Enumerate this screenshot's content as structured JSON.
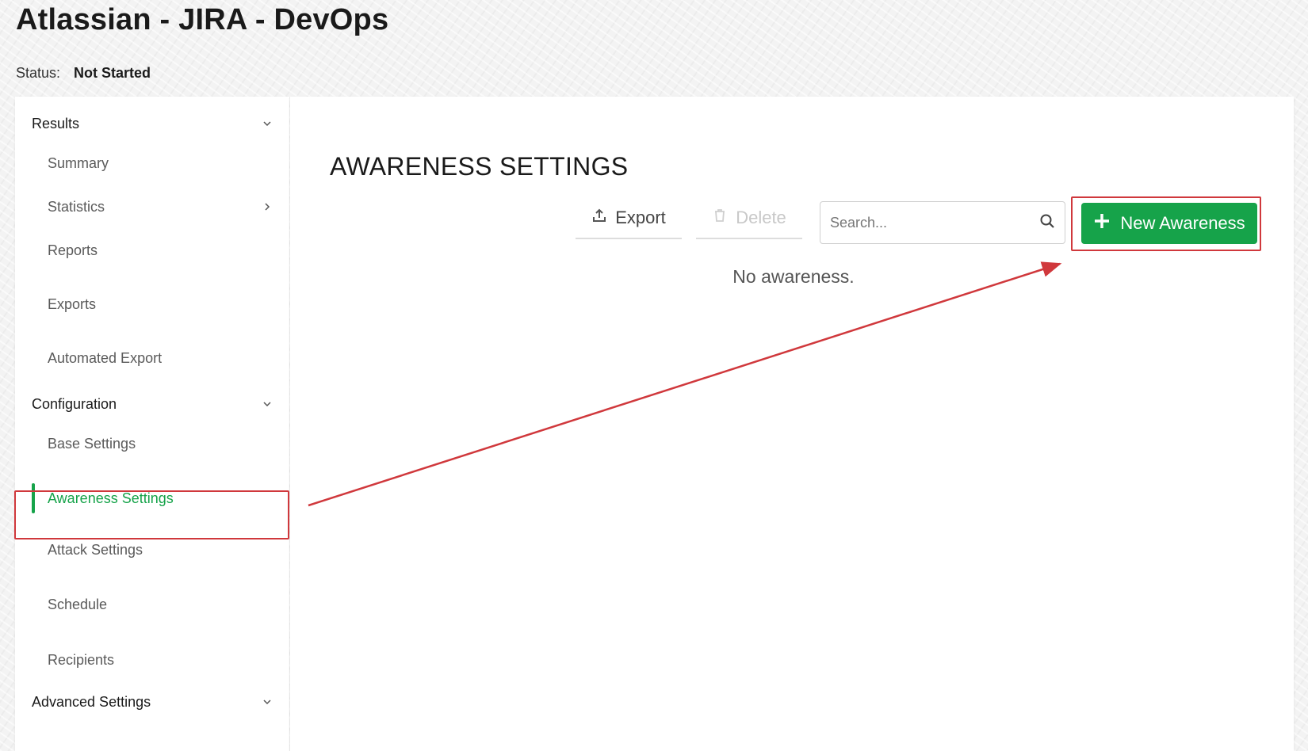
{
  "header": {
    "title": "Atlassian - JIRA - DevOps",
    "status_label": "Status:",
    "status_value": "Not Started"
  },
  "sidebar": {
    "sections": [
      {
        "label": "Results",
        "expanded": true
      },
      {
        "label": "Configuration",
        "expanded": true
      },
      {
        "label": "Advanced Settings",
        "expanded": true
      }
    ],
    "results_items": [
      {
        "label": "Summary"
      },
      {
        "label": "Statistics",
        "has_submenu": true
      },
      {
        "label": "Reports"
      },
      {
        "label": "Exports"
      },
      {
        "label": "Automated Export"
      }
    ],
    "configuration_items": [
      {
        "label": "Base Settings"
      },
      {
        "label": "Awareness Settings",
        "active": true
      },
      {
        "label": "Attack Settings"
      },
      {
        "label": "Schedule"
      },
      {
        "label": "Recipients"
      }
    ]
  },
  "main": {
    "heading": "AWARENESS SETTINGS",
    "export_label": "Export",
    "delete_label": "Delete",
    "search_placeholder": "Search...",
    "new_button_label": "New Awareness",
    "empty_message": "No awareness."
  },
  "colors": {
    "accent": "#16a34a",
    "highlight": "#d0383c",
    "disabled_text": "#c8c8c8"
  },
  "icons": {
    "export": "upload-icon",
    "delete": "trash-icon",
    "search": "search-icon",
    "new": "plus-icon",
    "section_toggle": "chevron-down-icon",
    "submenu": "chevron-right-icon"
  }
}
